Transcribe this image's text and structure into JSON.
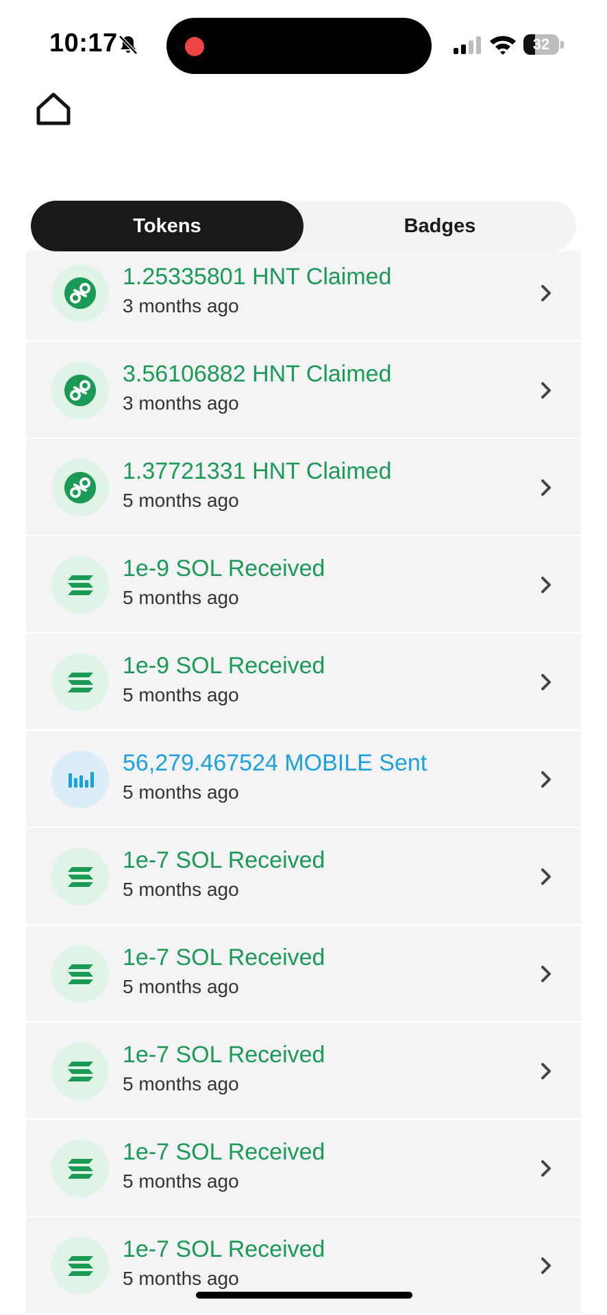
{
  "status_bar": {
    "time": "10:17",
    "battery": "32",
    "battery_level_pct": 32,
    "icons": [
      "bell-slash-icon",
      "signal-icon",
      "wifi-icon",
      "battery-icon"
    ]
  },
  "header": {
    "home_icon": "home-icon"
  },
  "tabs": [
    {
      "label": "Tokens",
      "active": true
    },
    {
      "label": "Badges",
      "active": false
    }
  ],
  "colors": {
    "hnt": "#1a9a54",
    "sol": "#1a9a54",
    "mobile": "#1da0e0",
    "hnt_icon_bg": "#dff3e6",
    "mobile_icon_bg": "#dcedfa",
    "row_bg": "#f4f3f6"
  },
  "transactions": [
    {
      "token": "hnt",
      "title": "1.25335801 HNT Claimed",
      "time": "3 months ago",
      "icon": "helium-icon"
    },
    {
      "token": "hnt",
      "title": "3.56106882 HNT Claimed",
      "time": "3 months ago",
      "icon": "helium-icon"
    },
    {
      "token": "hnt",
      "title": "1.37721331 HNT Claimed",
      "time": "5 months ago",
      "icon": "helium-icon"
    },
    {
      "token": "sol",
      "title": "1e-9 SOL Received",
      "time": "5 months ago",
      "icon": "solana-icon"
    },
    {
      "token": "sol",
      "title": "1e-9 SOL Received",
      "time": "5 months ago",
      "icon": "solana-icon"
    },
    {
      "token": "mobile",
      "title": "56,279.467524 MOBILE Sent",
      "time": "5 months ago",
      "icon": "mobile-token-icon"
    },
    {
      "token": "sol",
      "title": "1e-7 SOL Received",
      "time": "5 months ago",
      "icon": "solana-icon"
    },
    {
      "token": "sol",
      "title": "1e-7 SOL Received",
      "time": "5 months ago",
      "icon": "solana-icon"
    },
    {
      "token": "sol",
      "title": "1e-7 SOL Received",
      "time": "5 months ago",
      "icon": "solana-icon"
    },
    {
      "token": "sol",
      "title": "1e-7 SOL Received",
      "time": "5 months ago",
      "icon": "solana-icon"
    },
    {
      "token": "sol",
      "title": "1e-7 SOL Received",
      "time": "5 months ago",
      "icon": "solana-icon"
    }
  ]
}
